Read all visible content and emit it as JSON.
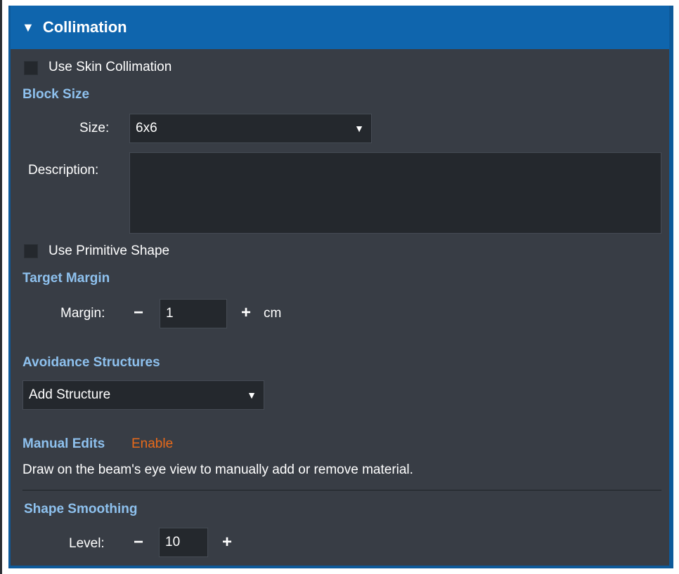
{
  "header": {
    "collapse_glyph": "▼",
    "title": "Collimation"
  },
  "use_skin": {
    "label": "Use Skin Collimation",
    "checked": false
  },
  "block_size": {
    "section": "Block Size",
    "size_label": "Size:",
    "size_value": "6x6",
    "dropdown_glyph": "▼",
    "description_label": "Description:",
    "description_value": ""
  },
  "use_primitive": {
    "label": "Use Primitive Shape",
    "checked": false
  },
  "target_margin": {
    "section": "Target Margin",
    "margin_label": "Margin:",
    "minus": "−",
    "value": "1",
    "plus": "+",
    "unit": "cm"
  },
  "avoidance": {
    "section": "Avoidance Structures",
    "add_label": "Add Structure",
    "dropdown_glyph": "▼"
  },
  "manual_edits": {
    "section": "Manual Edits",
    "enable_link": "Enable",
    "hint": "Draw on the beam's eye view to manually add or remove material."
  },
  "shape_smoothing": {
    "section": "Shape Smoothing",
    "level_label": "Level:",
    "minus": "−",
    "value": "10",
    "plus": "+"
  },
  "colors": {
    "header_bg": "#0f65ad",
    "panel_bg": "#383d45",
    "section_text": "#8ec1ee",
    "link_text": "#e86a1a",
    "field_bg": "#24282d"
  }
}
